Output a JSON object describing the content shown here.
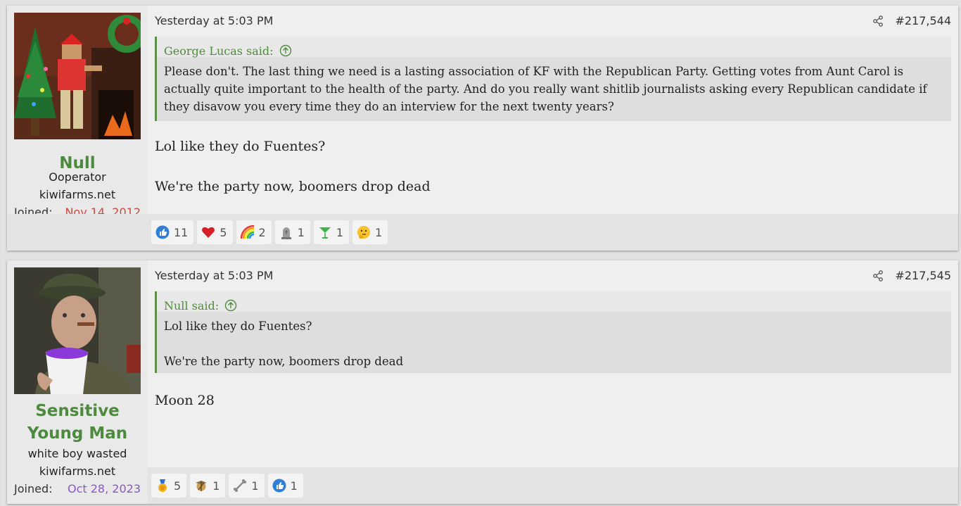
{
  "posts": [
    {
      "user": {
        "name": "Null",
        "title": "Ooperator",
        "banner": "kiwifarms.net",
        "joined_label": "Joined:",
        "joined_date": "Nov 14, 2012",
        "joined_color": "#c84a3e"
      },
      "date": "Yesterday at 5:03 PM",
      "number": "#217,544",
      "quote": {
        "author": "George Lucas said:",
        "text": "Please don't. The last thing we need is a lasting association of KF with the Republican Party. Getting votes from Aunt Carol is actually quite important to the health of the party. And do you really want shitlib journalists asking every Republican candidate if they disavow you every time they do an interview for the next twenty years?"
      },
      "message": [
        "Lol like they do Fuentes?",
        "We're the party now, boomers drop dead"
      ],
      "reactions": [
        {
          "icon": "thumbs-up-icon",
          "count": "11"
        },
        {
          "icon": "heart-icon",
          "count": "5"
        },
        {
          "icon": "rainbow-icon",
          "count": "2"
        },
        {
          "icon": "tombstone-icon",
          "count": "1"
        },
        {
          "icon": "cocktail-icon",
          "count": "1"
        },
        {
          "icon": "thinking-face-icon",
          "count": "1"
        }
      ]
    },
    {
      "user": {
        "name": "Sensitive Young Man",
        "title": "white boy wasted",
        "banner": "kiwifarms.net",
        "joined_label": "Joined:",
        "joined_date": "Oct 28, 2023",
        "joined_color": "#8a58c8"
      },
      "date": "Yesterday at 5:03 PM",
      "number": "#217,545",
      "quote": {
        "author": "Null said:",
        "text_lines": [
          "Lol like they do Fuentes?",
          "We're the party now, boomers drop dead"
        ]
      },
      "message": [
        "Moon 28"
      ],
      "reactions": [
        {
          "icon": "medal-icon",
          "count": "5"
        },
        {
          "icon": "marine-emblem-icon",
          "count": "1"
        },
        {
          "icon": "bone-icon",
          "count": "1"
        },
        {
          "icon": "thumbs-up-icon",
          "count": "1"
        }
      ]
    }
  ],
  "colors": {
    "username": "#4c8a3e",
    "quote_border": "#5c8f48",
    "quote_author": "#4d8c3a"
  }
}
